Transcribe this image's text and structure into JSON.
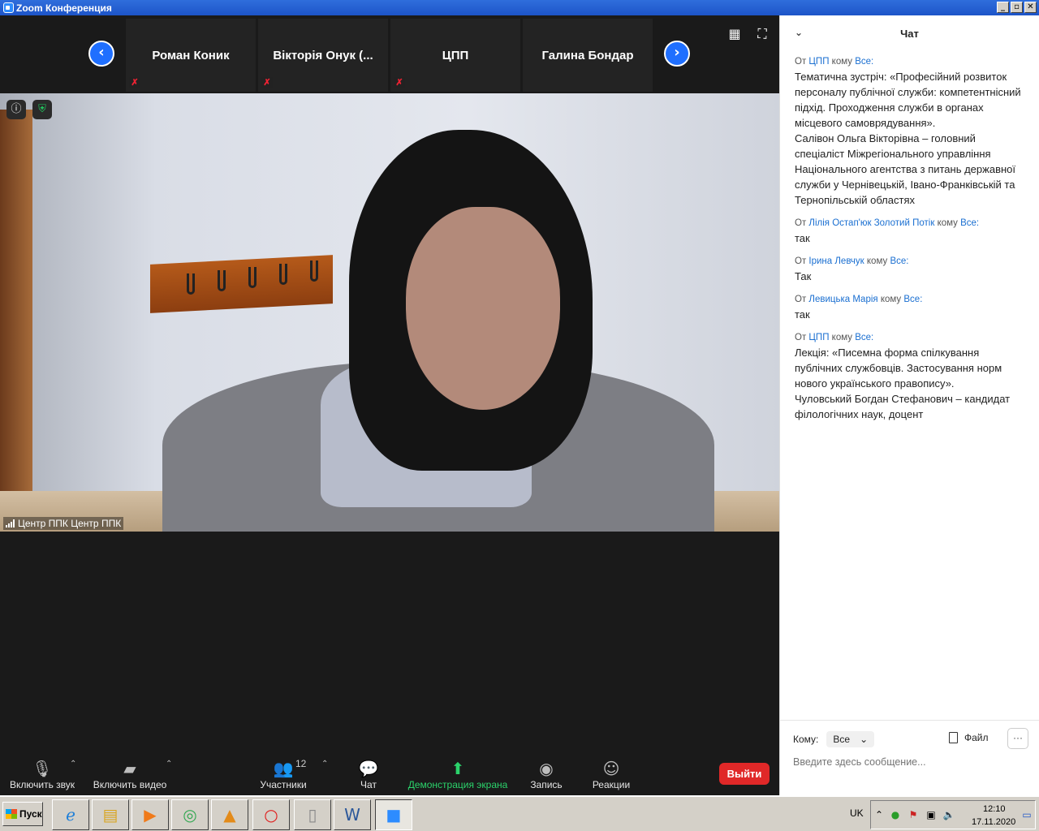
{
  "window": {
    "title": "Zoom Конференция",
    "buttons": [
      "_",
      "▫",
      "✕"
    ]
  },
  "strip": {
    "tiles": [
      {
        "name": "Роман Коник",
        "muted": true
      },
      {
        "name": "Вікторія  Онук (...",
        "muted": true
      },
      {
        "name": "ЦПП",
        "muted": true
      },
      {
        "name": "Галина Бондар",
        "muted": false
      }
    ]
  },
  "video": {
    "label": "Центр ППК Центр ППК"
  },
  "toolbar": {
    "mute_label": "Включить звук",
    "video_label": "Включить видео",
    "participants_label": "Участники",
    "participants_count": "12",
    "chat_label": "Чат",
    "share_label": "Демонстрация экрана",
    "record_label": "Запись",
    "reactions_label": "Реакции",
    "leave_label": "Выйти"
  },
  "chat": {
    "title": "Чат",
    "from_word": "От",
    "to_word": "кому",
    "messages": [
      {
        "from": "ЦПП",
        "to": "Все:",
        "text": "Тематична зустріч: «Професійний розвиток персоналу публічної служби: компетентнісний підхід. Проходження служби в органах місцевого самоврядування».\nСалівон Ольга Вікторівна – головний спеціаліст Міжрегіонального управління Національного агентства з питань державної служби у Чернівецькій, Івано-Франківській та Тернопільській областях"
      },
      {
        "from": "Лілія Остап'юк Золотий Потік",
        "to": "Все:",
        "text": "так"
      },
      {
        "from": "Ірина Левчук",
        "to": "Все:",
        "text": "Так"
      },
      {
        "from": "Левицька Марія",
        "to": "Все:",
        "text": "так"
      },
      {
        "from": "ЦПП",
        "to": "Все:",
        "text": "Лекція: «Писемна форма спілкування публічних службовців. Застосування норм нового українського правопису».\nЧуловський Богдан Стефанович – кандидат філологічних наук, доцент"
      }
    ],
    "to_label": "Кому:",
    "to_value": "Все",
    "file_label": "Файл",
    "more_label": "···",
    "input_placeholder": "Введите здесь сообщение..."
  },
  "taskbar": {
    "start_label": "Пуск",
    "lang": "UK",
    "time": "12:10",
    "date": "17.11.2020"
  },
  "colors": {
    "accent": "#1f6fff",
    "leave": "#e02828",
    "share": "#2bd36b",
    "link": "#1a6fd1"
  }
}
